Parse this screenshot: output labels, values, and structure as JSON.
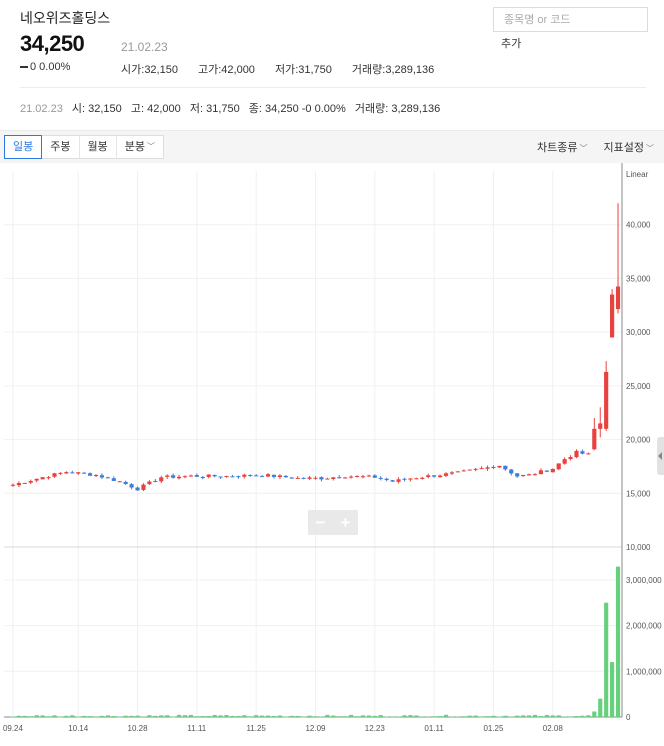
{
  "header": {
    "stock_name": "네오위즈홀딩스",
    "price": "34,250",
    "date": "21.02.23",
    "change": "0 0.00%",
    "stats": [
      {
        "label": "시가",
        "value": "32,150"
      },
      {
        "label": "고가",
        "value": "42,000"
      },
      {
        "label": "저가",
        "value": "31,750"
      },
      {
        "label": "거래량",
        "value": "3,289,136"
      }
    ]
  },
  "search": {
    "placeholder": "종목명 or 코드",
    "add_label": "추가"
  },
  "summary": {
    "date": "21.02.23",
    "items": [
      {
        "label": "시",
        "value": "32,150"
      },
      {
        "label": "고",
        "value": "42,000"
      },
      {
        "label": "저",
        "value": "31,750"
      },
      {
        "label": "종",
        "value": "34,250 -0 0.00%"
      },
      {
        "label": "거래량",
        "value": "3,289,136"
      }
    ]
  },
  "toolbar": {
    "tabs": [
      {
        "label": "일봉",
        "active": true
      },
      {
        "label": "주봉",
        "active": false
      },
      {
        "label": "월봉",
        "active": false
      },
      {
        "label": "분봉",
        "active": false
      }
    ],
    "chart_type_label": "차트종류",
    "indicator_label": "지표설정"
  },
  "zoom": {
    "minus": "−",
    "plus": "+"
  },
  "colors": {
    "up": "#e8413e",
    "down": "#3b7ddd",
    "volume": "#67d07d",
    "grid": "#f0f0f0",
    "axis_text": "#555555"
  },
  "chart_data": {
    "type": "candlestick",
    "scale_label": "Linear",
    "price_axis": {
      "min": 10000,
      "max": 45000,
      "ticks": [
        40000,
        35000,
        30000,
        25000,
        20000,
        15000,
        10000
      ]
    },
    "volume_axis": {
      "min": 0,
      "max": 3500000,
      "ticks": [
        3000000,
        2000000,
        1000000,
        0
      ]
    },
    "x_tick_labels": [
      {
        "label": "09.24",
        "index": 0
      },
      {
        "label": "10.14",
        "index": 11
      },
      {
        "label": "10.28",
        "index": 21
      },
      {
        "label": "11.11",
        "index": 31
      },
      {
        "label": "11.25",
        "index": 41
      },
      {
        "label": "12.09",
        "index": 51
      },
      {
        "label": "12.23",
        "index": 61
      },
      {
        "label": "01.11",
        "index": 71
      },
      {
        "label": "01.25",
        "index": 81
      },
      {
        "label": "02.08",
        "index": 91
      }
    ],
    "candles": [],
    "volumes": [],
    "base_path": [
      [
        0,
        15800
      ],
      [
        5,
        16500
      ],
      [
        9,
        17000
      ],
      [
        14,
        16700
      ],
      [
        18,
        16100
      ],
      [
        21,
        15400
      ],
      [
        25,
        16500
      ],
      [
        30,
        16600
      ],
      [
        36,
        16600
      ],
      [
        42,
        16700
      ],
      [
        48,
        16400
      ],
      [
        52,
        16400
      ],
      [
        56,
        16600
      ],
      [
        61,
        16500
      ],
      [
        64,
        16100
      ],
      [
        67,
        16400
      ],
      [
        70,
        16600
      ],
      [
        75,
        16900
      ],
      [
        78,
        17200
      ],
      [
        82,
        17600
      ],
      [
        85,
        16600
      ],
      [
        87,
        16700
      ],
      [
        91,
        17300
      ],
      [
        93,
        18200
      ],
      [
        95,
        18800
      ],
      [
        97,
        18600
      ]
    ],
    "tail": [
      {
        "o": 19100,
        "h": 22000,
        "l": 19000,
        "c": 21000
      },
      {
        "o": 21000,
        "h": 23000,
        "l": 20200,
        "c": 21500
      },
      {
        "o": 21000,
        "h": 27300,
        "l": 20800,
        "c": 26300
      },
      {
        "o": 29500,
        "h": 34000,
        "l": 29500,
        "c": 33500
      },
      {
        "o": 32150,
        "h": 42000,
        "l": 31750,
        "c": 34250
      }
    ],
    "tail_volumes": [
      120000,
      400000,
      2500000,
      1200000,
      3289136
    ]
  }
}
